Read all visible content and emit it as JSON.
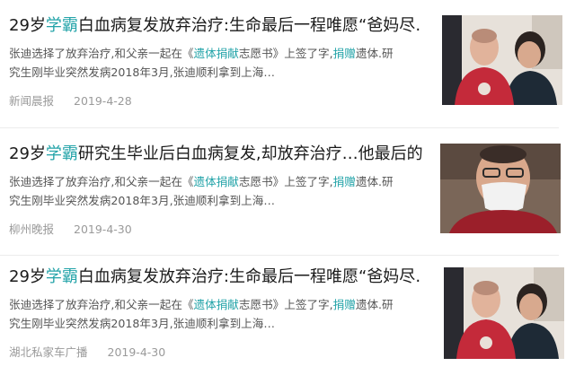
{
  "articles": [
    {
      "title_pre": "29岁",
      "title_hl": "学霸",
      "title_post": "白血病复发放弃治疗:生命最后一程唯愿“爸妈尽…",
      "snippet_a": "张迪选择了放弃治疗,和父亲一起在《",
      "snippet_kw1": "遗体捐献",
      "snippet_b": "志愿书》上签了字,",
      "snippet_kw2": "捐赠",
      "snippet_c": "遗体.研",
      "snippet_line2": "究生刚毕业突然发病2018年3月,张迪顺利拿到上海…",
      "source": "新闻晨报",
      "date": "2019-4-28",
      "image": "photo-patient-with-mother"
    },
    {
      "title_pre": "29岁",
      "title_hl": "学霸",
      "title_post": "研究生毕业后白血病复发,却放弃治疗…他最后的…",
      "snippet_a": "张迪选择了放弃治疗,和父亲一起在《",
      "snippet_kw1": "遗体捐献",
      "snippet_b": "志愿书》上签了字,",
      "snippet_kw2": "捐赠",
      "snippet_c": "遗体.研",
      "snippet_line2": "究生刚毕业突然发病2018年3月,张迪顺利拿到上海…",
      "source": "柳州晚报",
      "date": "2019-4-30",
      "image": "photo-patient-with-mask"
    },
    {
      "title_pre": "29岁",
      "title_hl": "学霸",
      "title_post": "白血病复发放弃治疗:生命最后一程唯愿“爸妈尽…",
      "snippet_a": "张迪选择了放弃治疗,和父亲一起在《",
      "snippet_kw1": "遗体捐献",
      "snippet_b": "志愿书》上签了字,",
      "snippet_kw2": "捐赠",
      "snippet_c": "遗体.研",
      "snippet_line2": "究生刚毕业突然发病2018年3月,张迪顺利拿到上海…",
      "source": "湖北私家车广播",
      "date": "2019-4-30",
      "image": "photo-patient-with-mother"
    }
  ],
  "colors": {
    "highlight": "#22a3a8",
    "meta": "#9a9a9a"
  }
}
